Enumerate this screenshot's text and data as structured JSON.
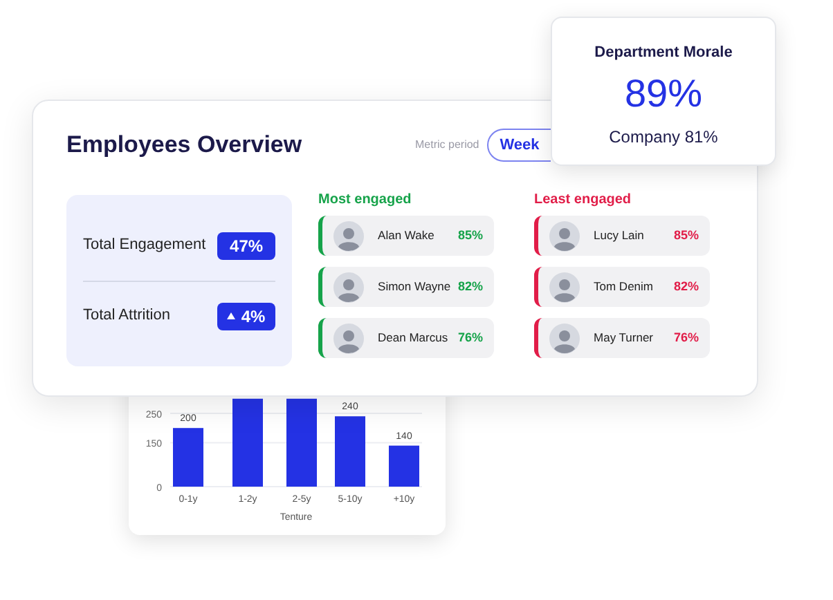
{
  "overview": {
    "title": "Employees Overview",
    "metric_period_label": "Metric period",
    "period_button": "Week"
  },
  "totals": [
    {
      "label": "Total Engagement",
      "value": "47%",
      "kind": "plain"
    },
    {
      "label": "Total Attrition",
      "value": "4%",
      "kind": "rise"
    }
  ],
  "groups": [
    {
      "kind": "most",
      "title": "Most engaged",
      "people": [
        {
          "name": "Alan Wake",
          "score": "85%"
        },
        {
          "name": "Simon Wayne",
          "score": "82%"
        },
        {
          "name": "Dean Marcus",
          "score": "76%"
        }
      ]
    },
    {
      "kind": "least",
      "title": "Least engaged",
      "people": [
        {
          "name": "Lucy Lain",
          "score": "85%"
        },
        {
          "name": "Tom Denim",
          "score": "82%"
        },
        {
          "name": "May Turner",
          "score": "76%"
        }
      ]
    }
  ],
  "morale": {
    "title": "Department Morale",
    "value": "89%",
    "company": "Company 81%"
  },
  "tenure_chart": {
    "chart_data": {
      "type": "bar",
      "xlabel": "Tenture",
      "categories": [
        "0-1y",
        "1-2y",
        "2-5y",
        "5-10y",
        "+10y"
      ],
      "series": [
        {
          "color": "#2432e4",
          "values": [
            200,
            300,
            300,
            240,
            140
          ]
        }
      ],
      "ylim": [
        0,
        300
      ],
      "yticks": [
        0,
        150,
        250
      ],
      "value_labels": [
        "200",
        null,
        null,
        "240",
        "140"
      ]
    }
  }
}
